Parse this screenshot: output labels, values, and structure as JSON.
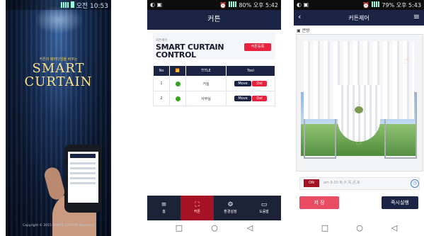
{
  "splash": {
    "time": "오전 10:53",
    "tagline": "커튼의 패러다임을 바꾸는",
    "brand_line1": "SMART",
    "brand_line2": "CURTAIN",
    "copyright": "Copyright © 2015 SMART CURTAIN Reserved"
  },
  "control": {
    "status": "80% 오후 5:42",
    "header": "커튼",
    "card_small": "커튼제어",
    "card_title_1": "SMART CURTAIN",
    "card_title_2": "CONTROL",
    "register_button": "커튼등록",
    "columns": [
      "No",
      "",
      "TITLE",
      "Tool"
    ],
    "rows": [
      {
        "no": "1",
        "title": "거실",
        "move": "Move",
        "del": "Del"
      },
      {
        "no": "2",
        "title": "사무실",
        "move": "Move",
        "del": "Del"
      }
    ],
    "bottom_nav": [
      {
        "icon": "≡",
        "label": "홈"
      },
      {
        "icon": "⛶",
        "label": "커튼"
      },
      {
        "icon": "⚙",
        "label": "환경설정"
      },
      {
        "icon": "▭",
        "label": "도움말"
      }
    ]
  },
  "detail": {
    "status": "79% 오후 5:43",
    "header": "커튼제어",
    "room_label": "큰방",
    "on_button": "ON",
    "schedule_text": "am 9:30  화,수,목,금,토",
    "save_button": "저 장",
    "run_button": "즉시실행"
  },
  "navbar": {
    "square": "□",
    "circle": "○",
    "back": "◁"
  }
}
